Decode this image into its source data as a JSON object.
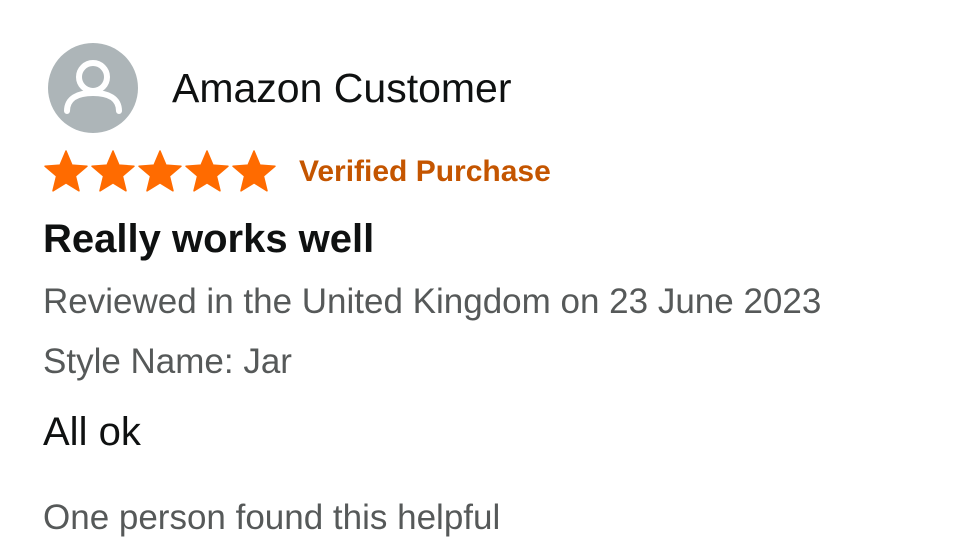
{
  "review": {
    "profile": {
      "name": "Amazon Customer",
      "avatar_icon": "user-silhouette-icon",
      "avatar_color": "#adb5b8"
    },
    "rating": {
      "value": 5,
      "max": 5,
      "star_icon": "star-icon",
      "star_color": "#ff6b00"
    },
    "badge": {
      "label": "Verified Purchase",
      "color": "#c45500"
    },
    "title": "Really works well",
    "date_line": "Reviewed in the United Kingdom on 23 June 2023",
    "style_line": "Style Name: Jar",
    "body": "All ok",
    "helpful_text": "One person found this helpful"
  }
}
